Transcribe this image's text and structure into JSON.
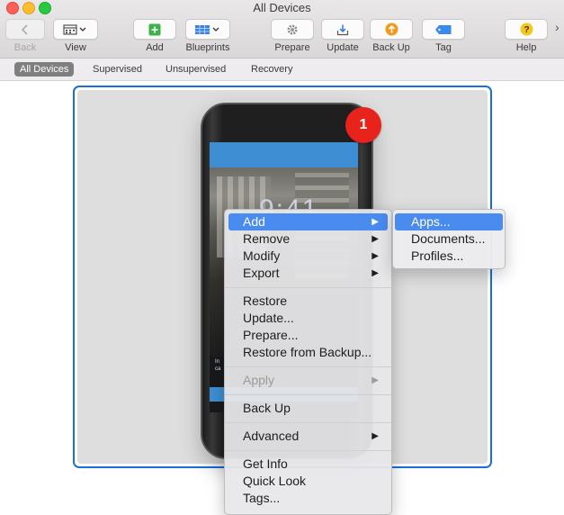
{
  "window": {
    "title": "All Devices"
  },
  "toolbar": {
    "back": "Back",
    "view": "View",
    "add": "Add",
    "blueprints": "Blueprints",
    "prepare": "Prepare",
    "update": "Update",
    "backup": "Back Up",
    "tag": "Tag",
    "help": "Help",
    "icons": {
      "back": "chevron-left-icon",
      "view": "calendar-grid-icon",
      "add": "plus-icon",
      "blueprints": "blueprint-grid-icon",
      "prepare": "gear-icon",
      "update": "download-tray-icon",
      "backup": "arrow-up-circle-icon",
      "tag": "tag-icon",
      "help": "question-icon"
    }
  },
  "scope": {
    "items": [
      "All Devices",
      "Supervised",
      "Unsupervised",
      "Recovery"
    ],
    "active": "All Devices"
  },
  "device": {
    "badge": "1",
    "clock": "9:41",
    "lockscreen_text": "In\nca"
  },
  "context_menu": {
    "items": [
      {
        "label": "Add",
        "submenu": true,
        "highlighted": true
      },
      {
        "label": "Remove",
        "submenu": true
      },
      {
        "label": "Modify",
        "submenu": true
      },
      {
        "label": "Export",
        "submenu": true
      },
      {
        "label": "Restore"
      },
      {
        "label": "Update..."
      },
      {
        "label": "Prepare..."
      },
      {
        "label": "Restore from Backup..."
      },
      {
        "label": "Apply",
        "submenu": true,
        "disabled": true
      },
      {
        "label": "Back Up"
      },
      {
        "label": "Advanced",
        "submenu": true
      },
      {
        "label": "Get Info"
      },
      {
        "label": "Quick Look"
      },
      {
        "label": "Tags..."
      }
    ]
  },
  "submenu": {
    "items": [
      {
        "label": "Apps...",
        "highlighted": true
      },
      {
        "label": "Documents..."
      },
      {
        "label": "Profiles..."
      }
    ]
  },
  "colors": {
    "accent": "#1a6fdb",
    "highlight": "#4a8bf0",
    "badge": "#e8231b"
  }
}
